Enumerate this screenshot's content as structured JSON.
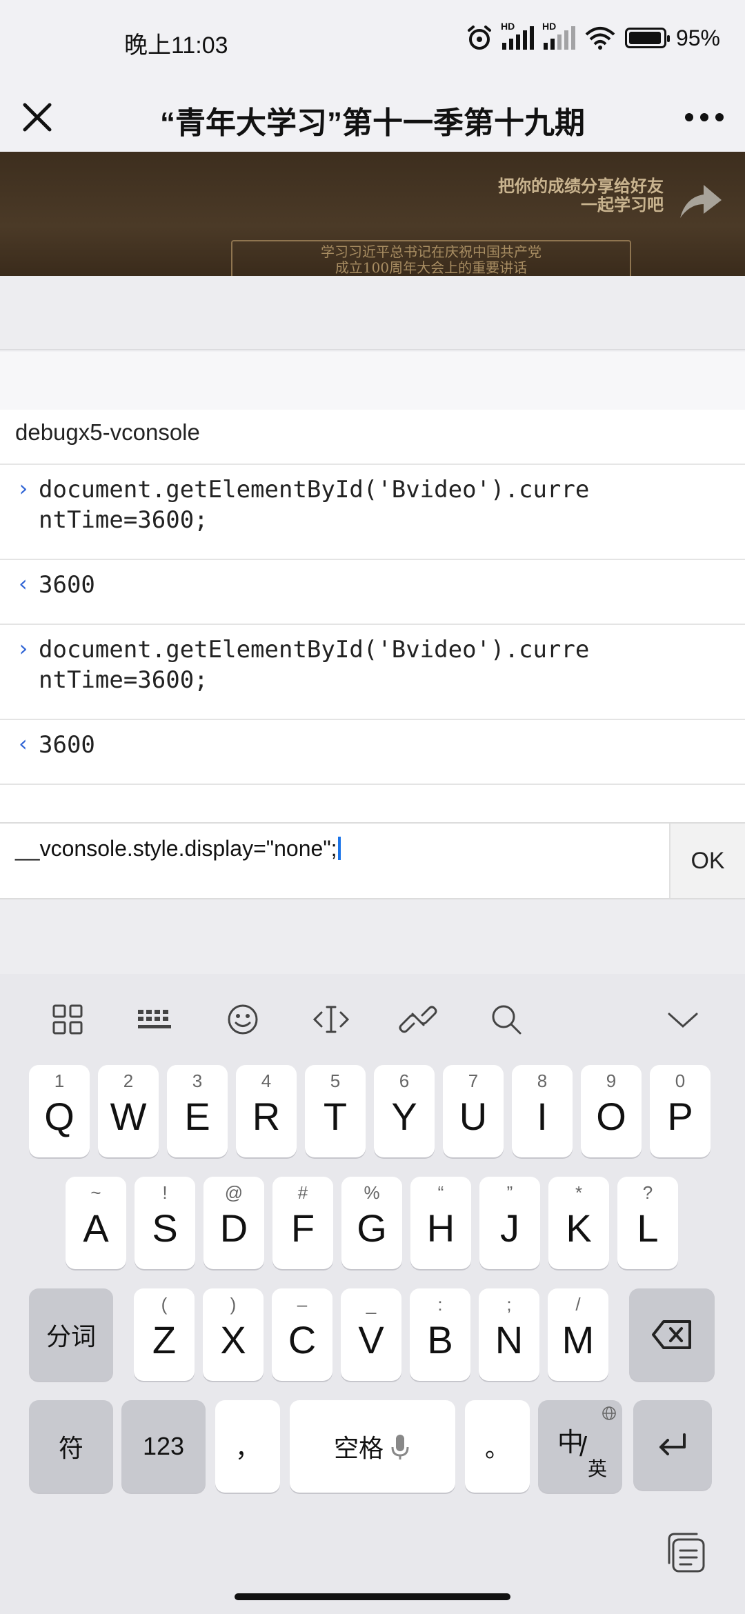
{
  "status_bar": {
    "time": "晚上11:03",
    "battery": "95%",
    "signal_label": "HD"
  },
  "nav": {
    "title": "“青年大学习”第十一季第十九期"
  },
  "banner": {
    "share_line1": "把你的成绩分享给好友",
    "share_line2": "一起学习吧",
    "quote_line1": "学习习近平总书记在庆祝中国共产党",
    "quote_line2": "成立100周年大会上的重要讲话"
  },
  "console": {
    "title": "debugx5-vconsole",
    "logs": [
      {
        "caret": "›",
        "text": "document.getElementById('Bvideo').curre\nntTime=3600;"
      },
      {
        "caret": "‹",
        "text": "3600"
      },
      {
        "caret": "›",
        "text": "document.getElementById('Bvideo').curre\nntTime=3600;"
      },
      {
        "caret": "‹",
        "text": "3600"
      }
    ],
    "input_value": "__vconsole.style.display=\"none\";",
    "ok_label": "OK"
  },
  "keyboard": {
    "row1": [
      {
        "hint": "1",
        "key": "Q"
      },
      {
        "hint": "2",
        "key": "W"
      },
      {
        "hint": "3",
        "key": "E"
      },
      {
        "hint": "4",
        "key": "R"
      },
      {
        "hint": "5",
        "key": "T"
      },
      {
        "hint": "6",
        "key": "Y"
      },
      {
        "hint": "7",
        "key": "U"
      },
      {
        "hint": "8",
        "key": "I"
      },
      {
        "hint": "9",
        "key": "O"
      },
      {
        "hint": "0",
        "key": "P"
      }
    ],
    "row2": [
      {
        "hint": "~",
        "key": "A"
      },
      {
        "hint": "!",
        "key": "S"
      },
      {
        "hint": "@",
        "key": "D"
      },
      {
        "hint": "#",
        "key": "F"
      },
      {
        "hint": "%",
        "key": "G"
      },
      {
        "hint": "“",
        "key": "H"
      },
      {
        "hint": "”",
        "key": "J"
      },
      {
        "hint": "*",
        "key": "K"
      },
      {
        "hint": "?",
        "key": "L"
      }
    ],
    "row3": [
      {
        "hint": "(",
        "key": "Z"
      },
      {
        "hint": ")",
        "key": "X"
      },
      {
        "hint": "–",
        "key": "C"
      },
      {
        "hint": "_",
        "key": "V"
      },
      {
        "hint": ":",
        "key": "B"
      },
      {
        "hint": ";",
        "key": "N"
      },
      {
        "hint": "/",
        "key": "M"
      }
    ],
    "segment_label": "分词",
    "symbol_label": "符",
    "num_label": "123",
    "comma_label": "，",
    "space_label": "空格",
    "period_label": "。",
    "lang_main": "中",
    "lang_sub": "英"
  }
}
